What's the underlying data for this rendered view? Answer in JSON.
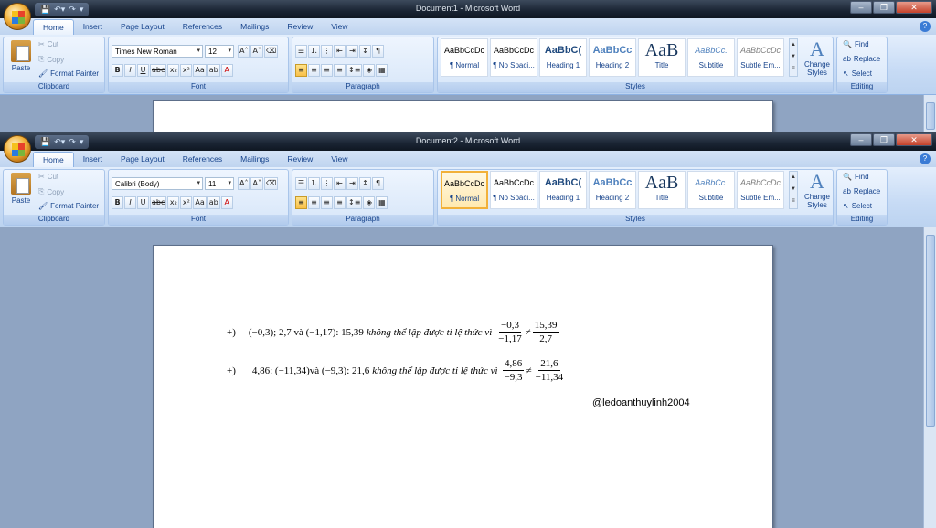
{
  "ribbon": {
    "tabs": [
      "Home",
      "Insert",
      "Page Layout",
      "References",
      "Mailings",
      "Review",
      "View"
    ],
    "clipboard": {
      "paste": "Paste",
      "cut": "Cut",
      "copy": "Copy",
      "format_painter": "Format Painter",
      "label": "Clipboard"
    },
    "font_label": "Font",
    "paragraph_label": "Paragraph",
    "styles_label": "Styles",
    "editing_label": "Editing",
    "styles": [
      {
        "preview": "AaBbCcDc",
        "name": "¶ Normal"
      },
      {
        "preview": "AaBbCcDc",
        "name": "¶ No Spaci..."
      },
      {
        "preview": "AaBbC(",
        "name": "Heading 1"
      },
      {
        "preview": "AaBbCc",
        "name": "Heading 2"
      },
      {
        "preview": "AaB",
        "name": "Title"
      },
      {
        "preview": "AaBbCc.",
        "name": "Subtitle"
      },
      {
        "preview": "AaBbCcDc",
        "name": "Subtle Em..."
      }
    ],
    "change_styles": "Change Styles",
    "find": "Find",
    "replace": "Replace",
    "select": "Select"
  },
  "window1": {
    "title": "Document1 - Microsoft Word",
    "font": "Times New Roman",
    "size": "12"
  },
  "window2": {
    "title": "Document2 - Microsoft Word",
    "font": "Calibri (Body)",
    "size": "11"
  },
  "document": {
    "line1": {
      "bullet": "+)",
      "text": "(−0,3); 2,7 và (−1,17): 15,39",
      "italic": "không thể lập được tỉ lệ thức vì",
      "f1_num": "−0,3",
      "f1_den": "−1,17",
      "neq": "≠",
      "f2_num": "15,39",
      "f2_den": "2,7"
    },
    "line2": {
      "bullet": "+)",
      "text": "4,86: (−11,34)và (−9,3): 21,6",
      "italic": "không thể lập được tỉ lệ thức vì",
      "f1_num": "4,86",
      "f1_den": "−9,3",
      "neq": "≠",
      "f2_num": "21,6",
      "f2_den": "−11,34"
    },
    "signature": "@ledoanthuylinh2004"
  }
}
